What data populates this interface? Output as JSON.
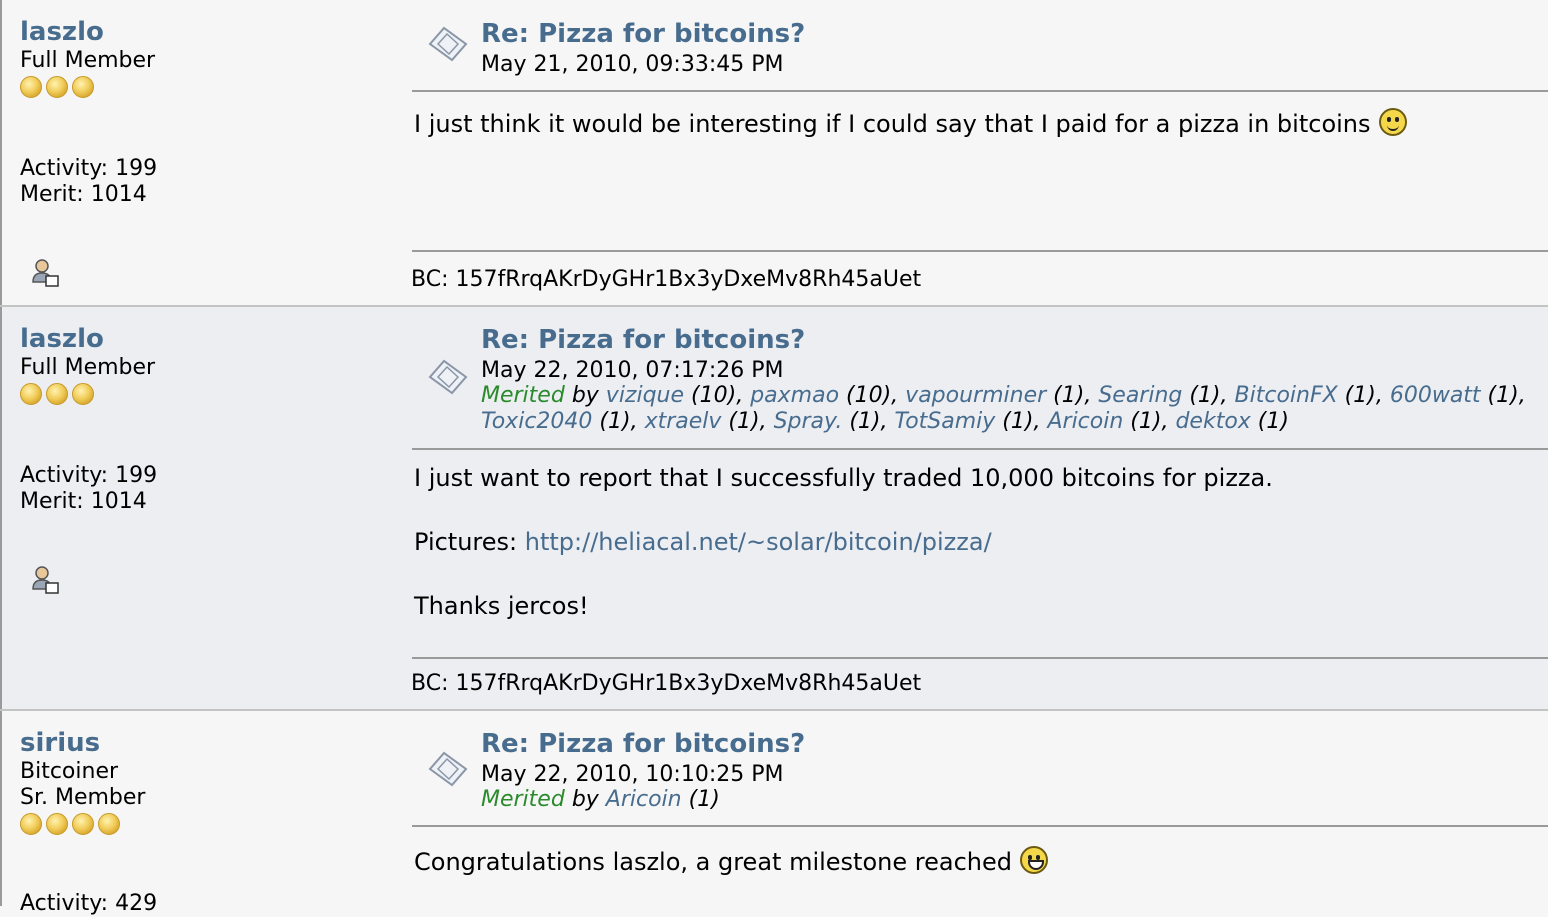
{
  "posts": [
    {
      "poster_name": "laszlo",
      "rank_lines": [
        "Full Member"
      ],
      "stars": 3,
      "activity": "Activity: 199",
      "merit": "Merit: 1014",
      "subject": "Re: Pizza for bitcoins?",
      "date": "May 21, 2010, 09:33:45 PM",
      "body": [
        "I just think it would be interesting if I could say that I paid for a pizza in bitcoins"
      ],
      "signature": "BC: 157fRrqAKrDyGHr1Bx3yDxeMv8Rh45aUet"
    },
    {
      "poster_name": "laszlo",
      "rank_lines": [
        "Full Member"
      ],
      "stars": 3,
      "activity": "Activity: 199",
      "merit": "Merit: 1014",
      "subject": "Re: Pizza for bitcoins?",
      "date": "May 22, 2010, 07:17:26 PM",
      "merited_label": "Merited",
      "merited_by": "by",
      "meriters": [
        {
          "name": "vizique",
          "count": "(10)"
        },
        {
          "name": "paxmao",
          "count": "(10)"
        },
        {
          "name": "vapourminer",
          "count": "(1)"
        },
        {
          "name": "Searing",
          "count": "(1)"
        },
        {
          "name": "BitcoinFX",
          "count": "(1)"
        },
        {
          "name": "600watt",
          "count": "(1)"
        },
        {
          "name": "Toxic2040",
          "count": "(1)"
        },
        {
          "name": "xtraelv",
          "count": "(1)"
        },
        {
          "name": "Spray.",
          "count": "(1)"
        },
        {
          "name": "TotSamiy",
          "count": "(1)"
        },
        {
          "name": "Aricoin",
          "count": "(1)"
        },
        {
          "name": "dektox",
          "count": "(1)"
        }
      ],
      "body_line1": "I just want to report that I successfully traded 10,000 bitcoins for pizza.",
      "pictures_label": "Pictures:",
      "pictures_link": "http://heliacal.net/~solar/bitcoin/pizza/",
      "body_line3": "Thanks jercos!",
      "signature": "BC: 157fRrqAKrDyGHr1Bx3yDxeMv8Rh45aUet"
    },
    {
      "poster_name": "sirius",
      "rank_lines": [
        "Bitcoiner",
        "Sr. Member"
      ],
      "stars": 4,
      "activity": "Activity: 429",
      "subject": "Re: Pizza for bitcoins?",
      "date": "May 22, 2010, 10:10:25 PM",
      "merited_label": "Merited",
      "merited_by": "by",
      "meriters": [
        {
          "name": "Aricoin",
          "count": "(1)"
        }
      ],
      "body": [
        "Congratulations laszlo, a great milestone reached"
      ]
    }
  ]
}
